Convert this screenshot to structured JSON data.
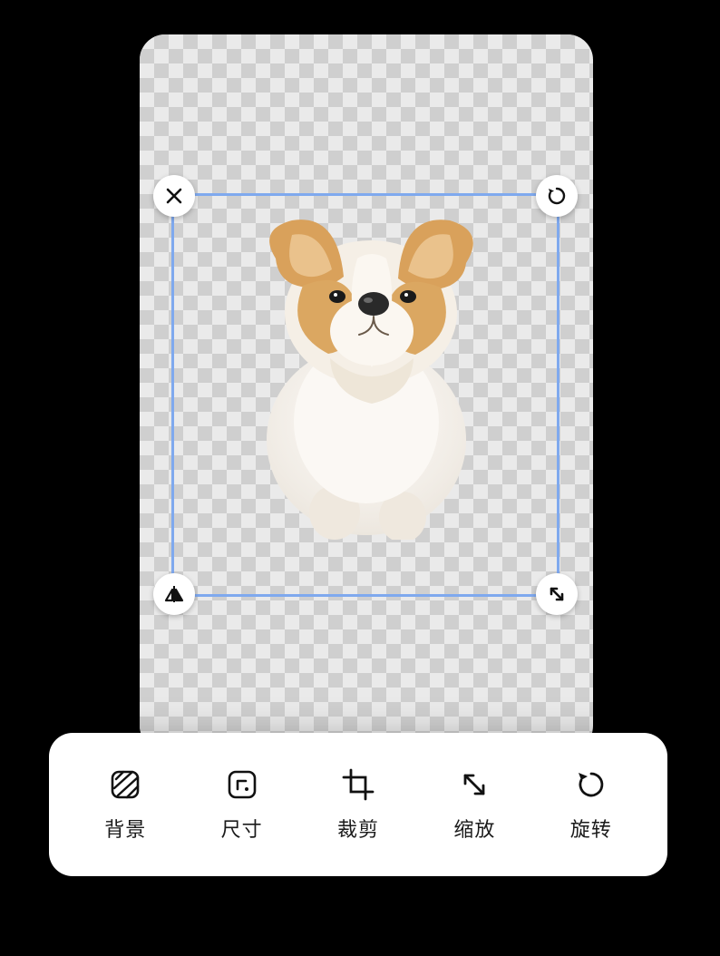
{
  "canvas": {
    "subject": "dog-cutout",
    "selection_handles": {
      "top_left": "close",
      "top_right": "rotate",
      "bottom_left": "mirror",
      "bottom_right": "scale"
    }
  },
  "toolbar": {
    "items": [
      {
        "id": "background",
        "label": "背景"
      },
      {
        "id": "size",
        "label": "尺寸"
      },
      {
        "id": "crop",
        "label": "裁剪"
      },
      {
        "id": "scale",
        "label": "缩放"
      },
      {
        "id": "rotate",
        "label": "旋转"
      }
    ]
  }
}
